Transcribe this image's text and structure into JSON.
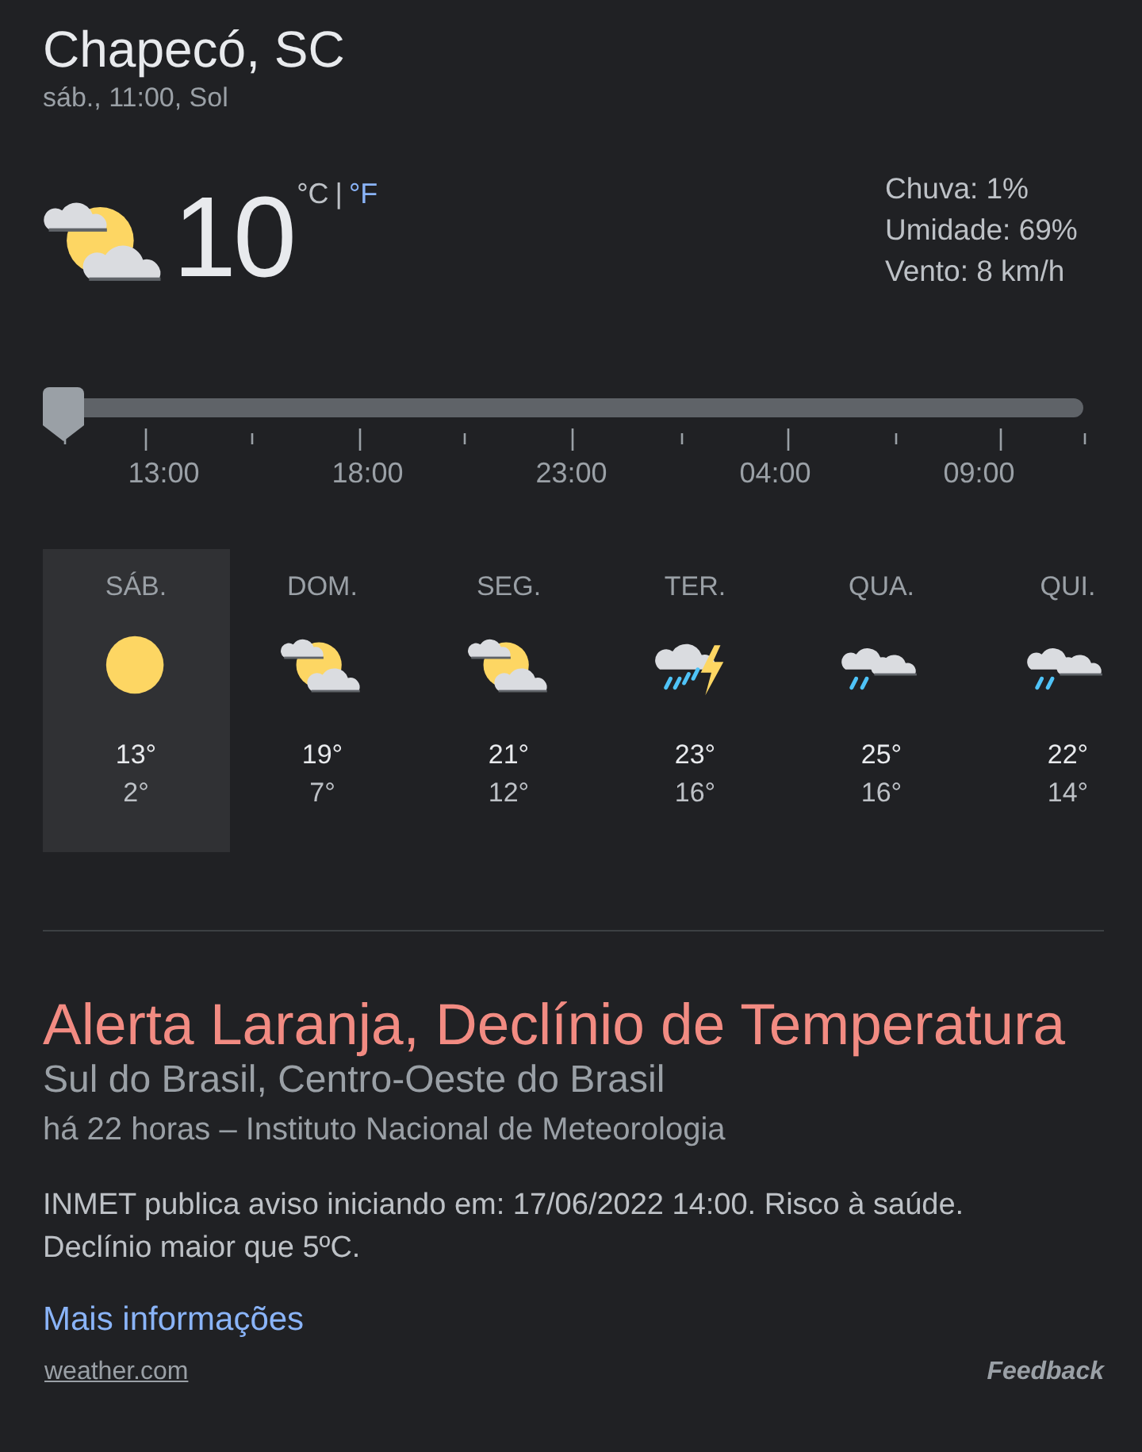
{
  "location": {
    "title": "Chapecó, SC",
    "subtitle": "sáb., 11:00, Sol"
  },
  "current": {
    "kind": "partly_cloudy",
    "temperature": "10",
    "units": [
      {
        "label": "°C",
        "selected": true
      },
      {
        "label": "°F",
        "selected": false
      }
    ],
    "unit_separator": "|",
    "details": [
      "Chuva: 1%",
      "Umidade: 69%",
      "Vento: 8 km/h"
    ]
  },
  "timeline": {
    "level": 0,
    "labels": [
      "13:00",
      "18:00",
      "23:00",
      "04:00",
      "09:00"
    ]
  },
  "forecast": [
    {
      "day": "SÁB.",
      "kind": "sunny",
      "high": "13°",
      "low": "2°",
      "selected": true
    },
    {
      "day": "DOM.",
      "kind": "partly_cloudy",
      "high": "19°",
      "low": "7°",
      "selected": false
    },
    {
      "day": "SEG.",
      "kind": "partly_cloudy",
      "high": "21°",
      "low": "12°",
      "selected": false
    },
    {
      "day": "TER.",
      "kind": "thunderstorm",
      "high": "23°",
      "low": "16°",
      "selected": false
    },
    {
      "day": "QUA.",
      "kind": "rain_cloudy",
      "high": "25°",
      "low": "16°",
      "selected": false
    },
    {
      "day": "QUI.",
      "kind": "rain_cloudy",
      "high": "22°",
      "low": "14°",
      "selected": false
    }
  ],
  "alert": {
    "title": "Alerta Laranja, Declínio de Temperatura",
    "regions": "Sul do Brasil, Centro-Oeste do Brasil",
    "meta": "há 22 horas – Instituto Nacional de Meteorologia",
    "body": "INMET publica aviso iniciando em: 17/06/2022 14:00. Risco à saúde. Declínio maior que 5ºC.",
    "link": "Mais informações"
  },
  "footer": {
    "source": "weather.com",
    "feedback": "Feedback"
  }
}
